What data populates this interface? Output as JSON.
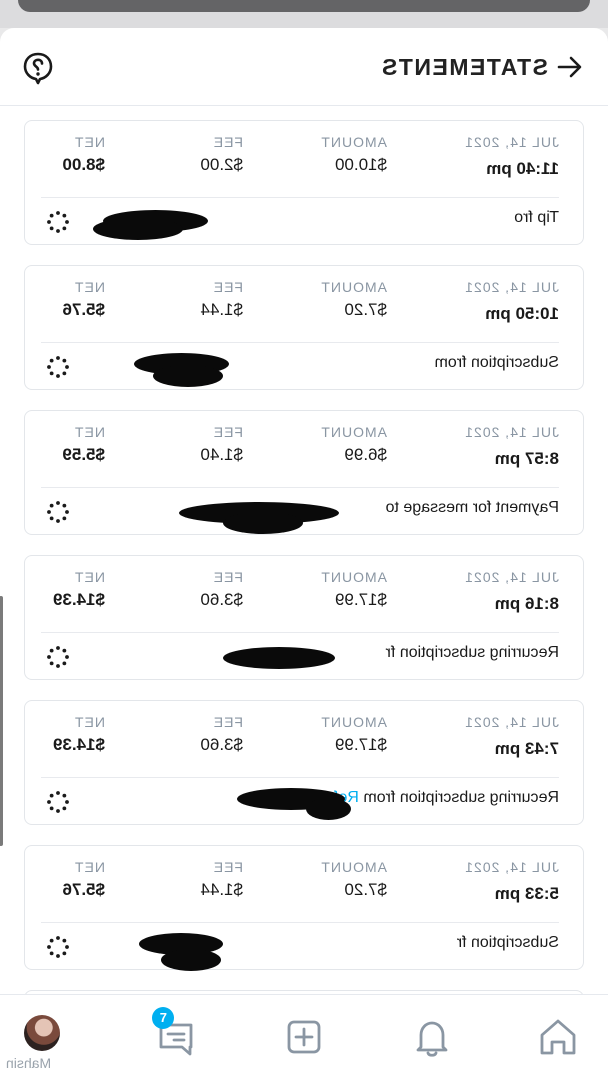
{
  "header": {
    "title": "STATEMENTS",
    "back_icon": "arrow-left-icon",
    "help_icon": "question-bubble-icon"
  },
  "columns": {
    "amount": "AMOUNT",
    "fee": "FEE",
    "net": "NET"
  },
  "transactions": [
    {
      "date": "JUL 14, 2021",
      "time": "11:40 pm",
      "amount": "$10.00",
      "fee": "$2.00",
      "net": "$8.00",
      "description": "Tip fro",
      "link": ""
    },
    {
      "date": "JUL 14, 2021",
      "time": "10:50 pm",
      "amount": "$7.20",
      "fee": "$1.44",
      "net": "$5.76",
      "description": "Subscription from",
      "link": ""
    },
    {
      "date": "JUL 14, 2021",
      "time": "8:57 pm",
      "amount": "$6.99",
      "fee": "$1.40",
      "net": "$5.59",
      "description": "Payment for message to",
      "link": ""
    },
    {
      "date": "JUL 14, 2021",
      "time": "8:16 pm",
      "amount": "$17.99",
      "fee": "$3.60",
      "net": "$14.39",
      "description": "Recurring subscription fr",
      "link": ""
    },
    {
      "date": "JUL 14, 2021",
      "time": "7:43 pm",
      "amount": "$17.99",
      "fee": "$3.60",
      "net": "$14.39",
      "description": "Recurring subscription from ",
      "link": "Refe C"
    },
    {
      "date": "JUL 14, 2021",
      "time": "5:33 pm",
      "amount": "$7.20",
      "fee": "$1.44",
      "net": "$5.76",
      "description": "Subscription fr",
      "link": ""
    }
  ],
  "nav": {
    "home_icon": "home-icon",
    "notifications_icon": "bell-icon",
    "create_icon": "plus-square-icon",
    "messages_icon": "chat-icon",
    "messages_badge": "7",
    "profile_name": "Mahsin"
  },
  "colors": {
    "accent": "#00aff0",
    "muted": "#8a96a3",
    "text": "#1a1a1a"
  }
}
